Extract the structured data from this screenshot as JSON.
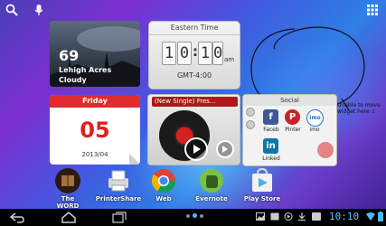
{
  "weather": {
    "temperature": "69",
    "location": "Lehigh Acres",
    "condition": "Cloudy"
  },
  "clock": {
    "header": "Eastern Time",
    "hour1": "1",
    "hour2": "0",
    "min1": "1",
    "min2": "0",
    "ampm": "am",
    "timezone": "GMT-4:00"
  },
  "calendar": {
    "weekday": "Friday",
    "day": "05",
    "year_month": "2013/04"
  },
  "music": {
    "title": "(New Single) Fres..."
  },
  "social": {
    "header": "Social",
    "items": [
      {
        "label": "Faceb"
      },
      {
        "label": "Pinter"
      },
      {
        "label": "imo"
      },
      {
        "label": "Linked"
      }
    ]
  },
  "note": {
    "text": "Unable to move widget here :("
  },
  "dock": {
    "apps": [
      {
        "label": "The WORD"
      },
      {
        "label": "PrinterShare"
      },
      {
        "label": "Web"
      },
      {
        "label": "Evernote"
      },
      {
        "label": "Play Store"
      }
    ]
  },
  "status": {
    "time": "10:10"
  },
  "colors": {
    "calendar_red": "#e02c2c",
    "facebook": "#3b5998",
    "pinterest": "#cb2027",
    "linkedin": "#0e76a8",
    "clock_accent": "#5fc7ff"
  }
}
